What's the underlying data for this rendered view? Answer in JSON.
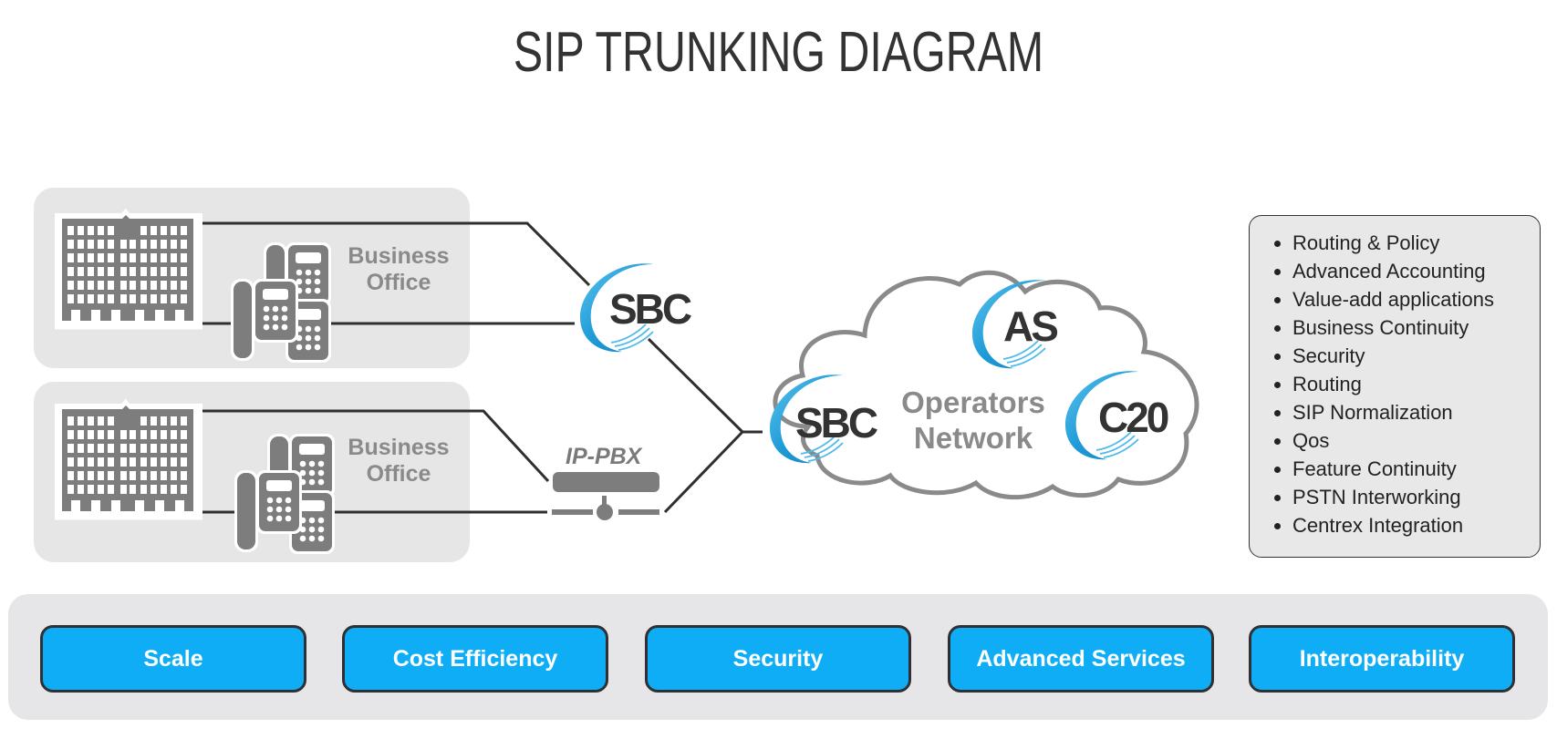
{
  "title": "SIP TRUNKING DIAGRAM",
  "offices": [
    {
      "label_line1": "Business",
      "label_line2": "Office",
      "icons": [
        "building-icon",
        "phones-icon"
      ]
    },
    {
      "label_line1": "Business",
      "label_line2": "Office",
      "icons": [
        "building-icon",
        "phones-icon"
      ]
    }
  ],
  "nodes": {
    "edge_sbc": "SBC",
    "ip_pbx": "IP-PBX",
    "cloud_sbc": "SBC",
    "as": "AS",
    "c20": "C20"
  },
  "cloud": {
    "label_line1": "Operators",
    "label_line2": "Network"
  },
  "features": [
    "Routing & Policy",
    "Advanced Accounting",
    "Value-add applications",
    "Business Continuity",
    "Security",
    "Routing",
    "SIP Normalization",
    "Qos",
    "Feature Continuity",
    "PSTN Interworking",
    "Centrex Integration"
  ],
  "benefits": [
    "Scale",
    "Cost Efficiency",
    "Security",
    "Advanced Services",
    "Interoperability"
  ],
  "colors": {
    "accent_blue": "#0fadf5",
    "ring_blue": "#1e9bd7",
    "icon_gray": "#7d7d7d",
    "panel_gray": "#e6e6e6",
    "dark_text": "#333333"
  }
}
